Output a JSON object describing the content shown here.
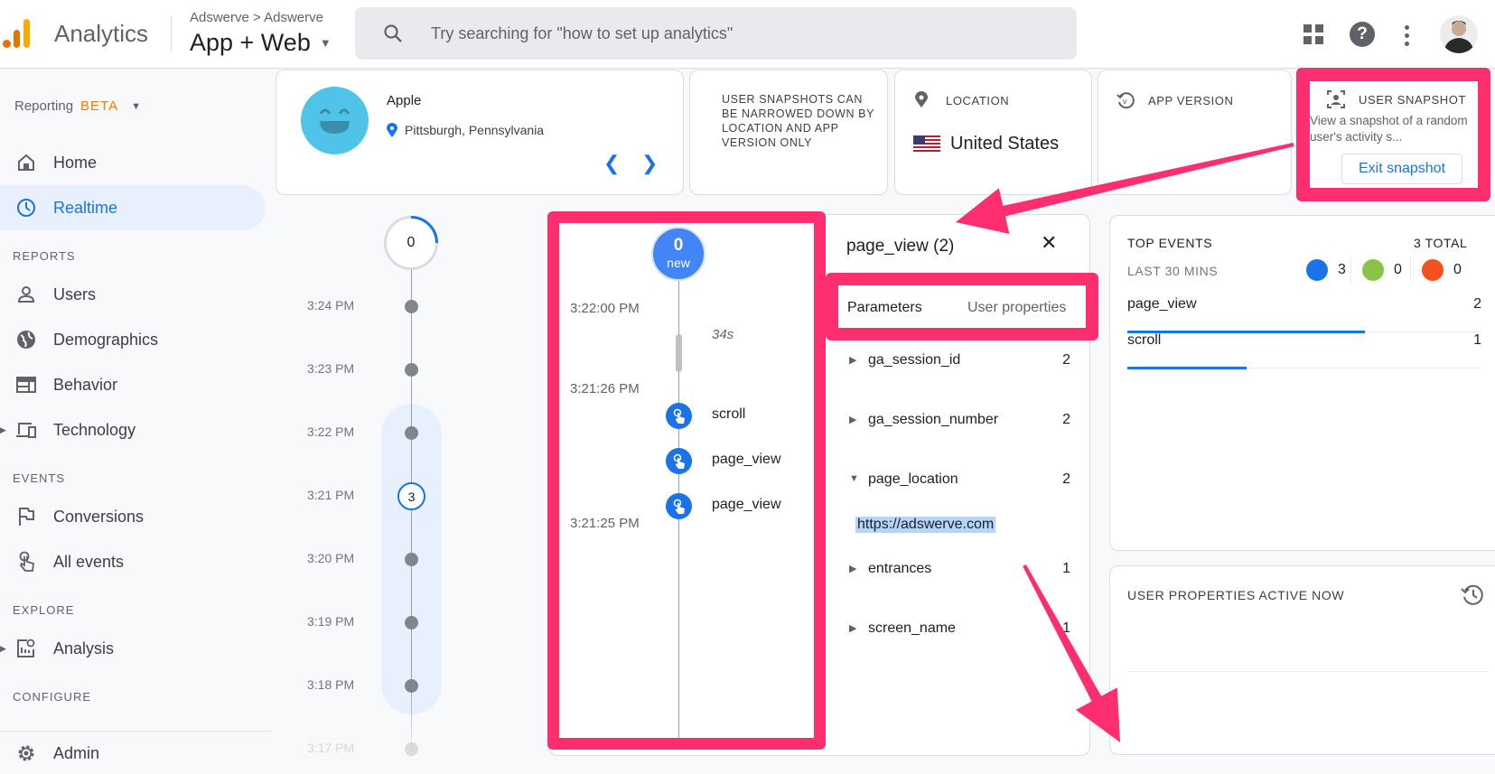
{
  "header": {
    "app_name": "Analytics",
    "breadcrumb": "Adswerve > Adswerve",
    "property": "App + Web",
    "search_placeholder": "Try searching for \"how to set up analytics\"",
    "icons": [
      "apps-grid-icon",
      "help-icon",
      "more-vert-icon",
      "avatar"
    ]
  },
  "sidebar": {
    "reporting": {
      "label": "Reporting",
      "badge": "BETA"
    },
    "items": [
      {
        "label": "Home",
        "icon": "home-icon"
      },
      {
        "label": "Realtime",
        "icon": "clock-icon",
        "active": true
      }
    ],
    "sections": [
      {
        "title": "REPORTS",
        "items": [
          {
            "label": "Users",
            "icon": "person-icon"
          },
          {
            "label": "Demographics",
            "icon": "globe-icon"
          },
          {
            "label": "Behavior",
            "icon": "web-icon"
          },
          {
            "label": "Technology",
            "icon": "devices-icon"
          }
        ]
      },
      {
        "title": "EVENTS",
        "items": [
          {
            "label": "Conversions",
            "icon": "flag-icon"
          },
          {
            "label": "All events",
            "icon": "touch-icon"
          }
        ]
      },
      {
        "title": "EXPLORE",
        "items": [
          {
            "label": "Analysis",
            "icon": "analysis-icon"
          }
        ]
      },
      {
        "title": "CONFIGURE",
        "items": []
      }
    ],
    "admin": {
      "label": "Admin",
      "icon": "gear-icon"
    }
  },
  "user_card": {
    "name": "Apple",
    "location": "Pittsburgh, Pennsylvania"
  },
  "note_card": {
    "text": "USER SNAPSHOTS CAN BE NARROWED DOWN BY LOCATION AND APP VERSION ONLY"
  },
  "location_card": {
    "title": "LOCATION",
    "value": "United States"
  },
  "app_version_card": {
    "title": "APP VERSION"
  },
  "snapshot_card": {
    "title": "USER SNAPSHOT",
    "description": "View a snapshot of a random user's activity s...",
    "exit_button": "Exit snapshot"
  },
  "timeline": {
    "top_count": "0",
    "minutes": [
      "3:24 PM",
      "3:23 PM",
      "3:22 PM",
      "3:21 PM",
      "3:20 PM",
      "3:19 PM",
      "3:18 PM",
      "3:17 PM"
    ],
    "active_count": "3"
  },
  "event_stream": {
    "new_count": "0",
    "new_label": "new",
    "times": [
      "3:22:00 PM",
      "3:21:26 PM",
      "3:21:25 PM"
    ],
    "gap": "34s",
    "events": [
      "scroll",
      "page_view",
      "page_view"
    ]
  },
  "detail": {
    "title": "page_view (2)",
    "tabs": [
      "Parameters",
      "User properties"
    ],
    "params": [
      {
        "name": "ga_session_id",
        "value": "2",
        "expanded": false
      },
      {
        "name": "ga_session_number",
        "value": "2",
        "expanded": false
      },
      {
        "name": "page_location",
        "value": "2",
        "expanded": true,
        "detail": "https://adswerve.com"
      },
      {
        "name": "entrances",
        "value": "1",
        "expanded": false
      },
      {
        "name": "screen_name",
        "value": "1",
        "expanded": false
      }
    ]
  },
  "top_events": {
    "title": "TOP EVENTS",
    "total": "3 TOTAL",
    "period": "LAST 30 MINS",
    "counts": [
      {
        "icon": "touch-icon",
        "value": "3",
        "color": "#1a73e8"
      },
      {
        "icon": "flag-icon",
        "value": "0",
        "color": "#8bc34a"
      },
      {
        "icon": "bug-icon",
        "value": "0",
        "color": "#f4511e"
      }
    ],
    "rows": [
      {
        "name": "page_view",
        "value": "2",
        "share": 1.0
      },
      {
        "name": "scroll",
        "value": "1",
        "share": 0.5
      }
    ]
  },
  "user_properties": {
    "title": "USER PROPERTIES ACTIVE NOW"
  },
  "colors": {
    "accent": "#1a73e8",
    "annotation": "#ff2e6e",
    "beta": "#f57c00"
  }
}
